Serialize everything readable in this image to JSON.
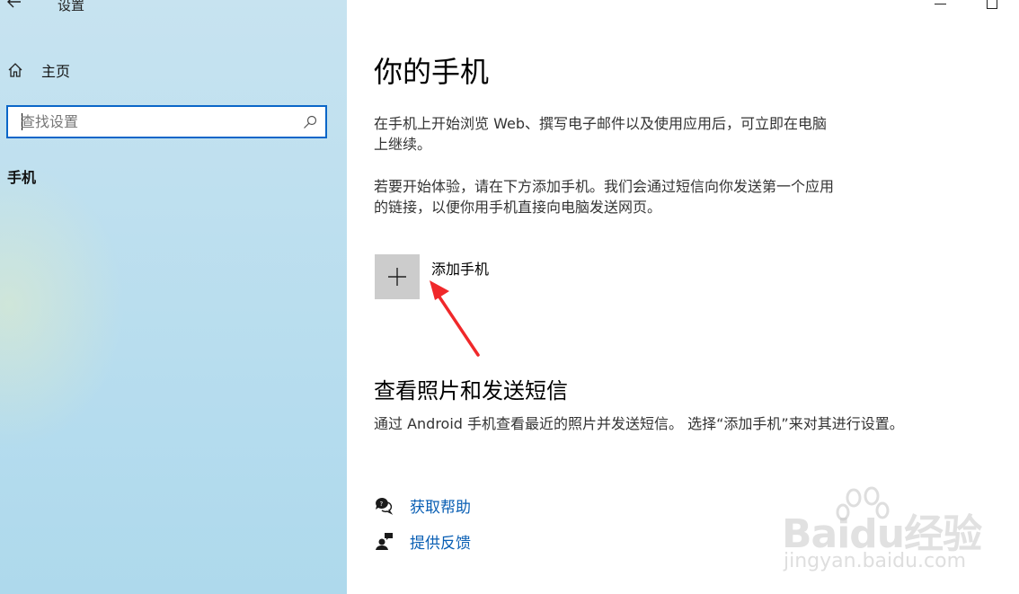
{
  "window": {
    "title": "设置",
    "back_icon": "back-arrow-icon",
    "controls": [
      "minimize",
      "maximize"
    ]
  },
  "sidebar": {
    "home_label": "主页",
    "search_placeholder": "查找设置",
    "search_value": "",
    "category": "手机"
  },
  "main": {
    "title": "你的手机",
    "intro": "在手机上开始浏览 Web、撰写电子邮件以及使用应用后，可立即在电脑上继续。",
    "intro_lines": [
      "在手机上开始浏览 Web、撰写电子邮件以及使用应用后，可立即在电脑",
      "上继续。"
    ],
    "instruction_lines": [
      "若要开始体验，请在下方添加手机。我们会通过短信向你发送第一个应用",
      "的链接，以便你用手机直接向电脑发送网页。"
    ],
    "add_phone_label": "添加手机",
    "section_title": "查看照片和发送短信",
    "section_desc": "通过 Android 手机查看最近的照片并发送短信。 选择“添加手机”来对其进行设置。",
    "links": [
      {
        "label": "获取帮助",
        "icon": "help-chat-icon"
      },
      {
        "label": "提供反馈",
        "icon": "feedback-person-icon"
      }
    ]
  },
  "annotation": {
    "arrow_color": "#f0282a"
  },
  "watermark": {
    "brand": "Baidu经验",
    "url": "jingyan.baidu.com"
  },
  "colors": {
    "accent": "#0a66c8",
    "link": "#0a5fb4",
    "sidebar_bg": "#bfe0ef",
    "add_button_bg": "#cccccc"
  }
}
